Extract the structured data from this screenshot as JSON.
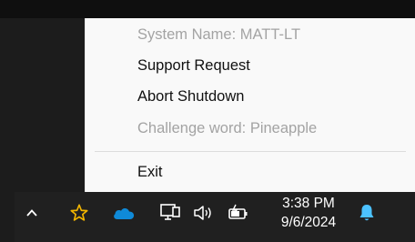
{
  "context_menu": {
    "items": [
      {
        "label": "System Name: MATT-LT",
        "enabled": false
      },
      {
        "label": "Support Request",
        "enabled": true
      },
      {
        "label": "Abort Shutdown",
        "enabled": true
      },
      {
        "label": "Challenge word: Pineapple",
        "enabled": false
      },
      {
        "label": "Exit",
        "enabled": true
      }
    ]
  },
  "taskbar": {
    "icons": [
      "chevron-up-icon",
      "star-icon",
      "onedrive-cloud-icon",
      "network-icon",
      "speaker-icon",
      "battery-icon",
      "bell-icon"
    ],
    "clock": {
      "time": "3:38 PM",
      "date": "9/6/2024"
    }
  },
  "colors": {
    "menu_background": "#f9f9f9",
    "taskbar_background": "#202020",
    "star": "#f2b500",
    "onedrive": "#0f8ad8",
    "notification_bell": "#4cc2ff"
  }
}
